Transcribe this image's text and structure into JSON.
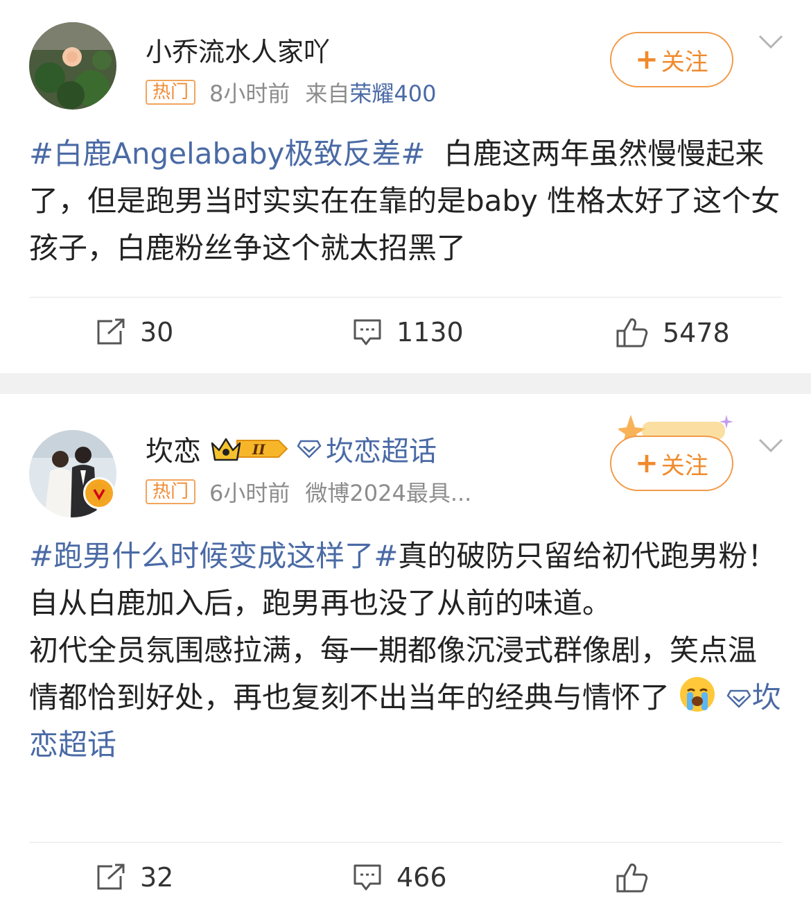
{
  "post1": {
    "username": "小乔流水人家吖",
    "hot_badge": "热门",
    "time": "8小时前",
    "source_prefix": "来自",
    "source_name": "荣耀400",
    "follow_label": "关注",
    "follow_plus": "+",
    "content": {
      "topic": "#白鹿Angelababy极致反差#",
      "text": "白鹿这两年虽然慢慢起来了，但是跑男当时实实在在靠的是baby 性格太好了这个女孩子，白鹿粉丝争这个就太招黑了"
    },
    "actions": {
      "repost": "30",
      "comment": "1130",
      "like": "5478"
    }
  },
  "post2": {
    "username": "坎恋",
    "vip_level": "II",
    "supertopic_label": "坎恋超话",
    "hot_badge": "热门",
    "time": "6小时前",
    "source": "微博2024最具...",
    "follow_label": "关注",
    "follow_plus": "+",
    "content": {
      "topic": "#跑男什么时候变成这样了#",
      "line1": "真的破防只留给初代跑男粉！自从白鹿加入后，跑男再也没了从前的味道。",
      "line2": "初代全员氛围感拉满，每一期都像沉浸式群像剧，笑点温情都恰到好处，再也复刻不出当年的经典与情怀了",
      "supertopic_inline": "坎恋超话"
    },
    "actions": {
      "repost": "32",
      "comment": "466",
      "like": ""
    }
  },
  "colors": {
    "accent_orange": "#f08a2c",
    "topic_blue": "#4a6aa5",
    "muted_gray": "#8c8c8c"
  }
}
